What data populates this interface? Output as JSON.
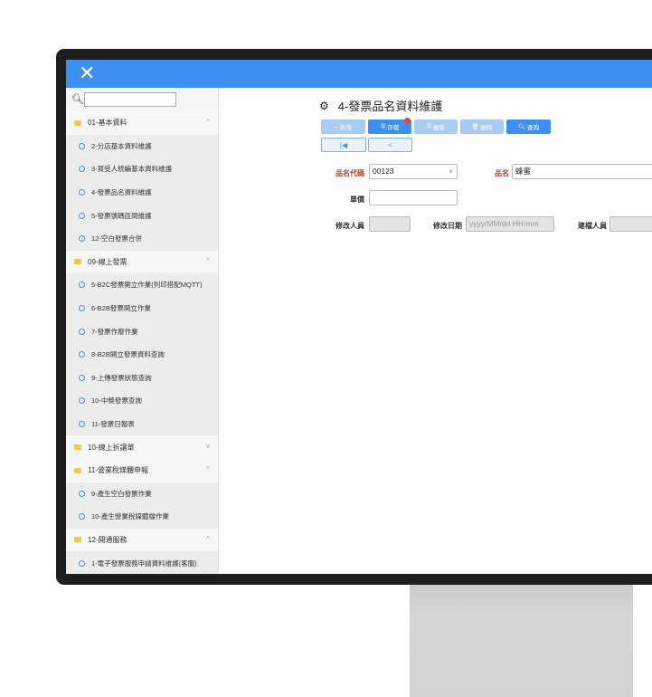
{
  "sidebar": {
    "search_placeholder": "",
    "groups": [
      {
        "label": "01-基本資料",
        "chevron": "^",
        "items": [
          "2-分店基本資料維護",
          "3-買受人統編基本資料維護",
          "4-發票品名資料維護",
          "5-發票號碼區間維護",
          "12-空白發票合併"
        ]
      },
      {
        "label": "09-線上發票",
        "chevron": "^",
        "items": [
          "5-B2C發票開立作業(列印搭配MQTT)",
          "6-B2B發票開立作業",
          "7-發票作廢作業",
          "8-B2B開立發票資料查詢",
          "9-上傳發票狀態查詢",
          "10-中獎發票查詢",
          "11-發票日報表"
        ]
      },
      {
        "label": "10-線上折讓單",
        "chevron": "v",
        "items": []
      },
      {
        "label": "11-營業稅媒體申報",
        "chevron": "^",
        "items": [
          "9-產生空白發票作業",
          "10-產生營業稅媒體檔作業"
        ]
      },
      {
        "label": "12-開通服務",
        "chevron": "^",
        "items": [
          "1-電子發票服務申請資料維護(客服)"
        ]
      }
    ]
  },
  "main": {
    "title": "4-發票品名資料維護",
    "toolbar": {
      "add": "+ 新增",
      "save": "存檔",
      "copy": "複製",
      "delete": "刪除",
      "query": "查詢",
      "first": "|◀",
      "prev": "<"
    },
    "form": {
      "code_label": "品名代碼",
      "code_value": "00123",
      "clear": "×",
      "name_label": "品名",
      "name_value": "蜂蜜",
      "price_label": "單價",
      "price_value": "",
      "modifier_label": "修改人員",
      "modifier_value": "",
      "mod_date_label": "修改日期",
      "mod_date_placeholder": "yyyy/MM/dd   HH:mm",
      "creator_label": "建檔人員",
      "creator_value": ""
    }
  },
  "colors": {
    "accent": "#3d8ff0",
    "accent_light": "#a8ccf4",
    "required": "#c0392b",
    "folder": "#f3c94a"
  }
}
